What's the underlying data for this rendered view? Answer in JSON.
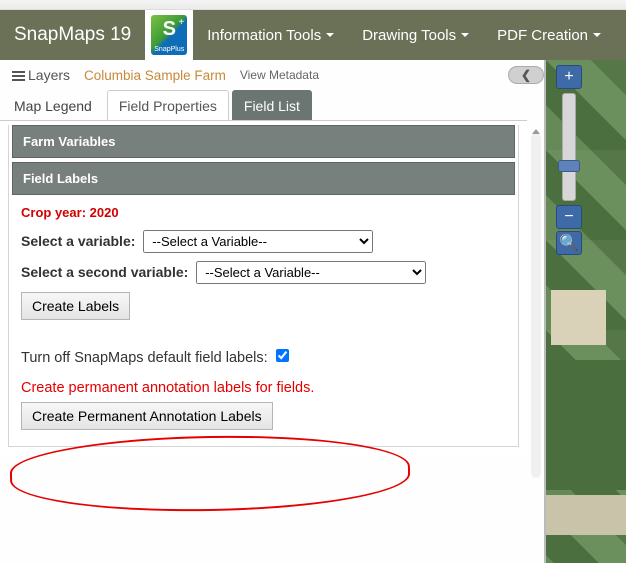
{
  "brand": "SnapMaps 19",
  "logo": {
    "letter": "S",
    "word": "SnapPlus"
  },
  "nav": [
    {
      "label": "Information Tools"
    },
    {
      "label": "Drawing Tools"
    },
    {
      "label": "PDF Creation"
    }
  ],
  "toolbar": {
    "layers": "Layers",
    "farm_name": "Columbia Sample Farm",
    "view_metadata": "View Metadata",
    "collapse_glyph": "❮"
  },
  "tabs": {
    "legend": "Map Legend",
    "properties": "Field Properties",
    "list": "Field List"
  },
  "accordion": {
    "farm_vars": "Farm Variables",
    "field_labels": "Field Labels"
  },
  "body": {
    "crop_year_label": "Crop year: 2020",
    "select1_label": "Select a variable:",
    "select2_label": "Select a second variable:",
    "select_placeholder": "--Select a Variable--",
    "create_labels_btn": "Create Labels",
    "toggle_label": "Turn off SnapMaps default field labels:",
    "annotation_note": "Create permanent annotation labels for fields.",
    "create_annotation_btn": "Create Permanent Annotation Labels"
  },
  "map_controls": {
    "zoom_in": "+",
    "zoom_out": "−",
    "search": "🔍"
  }
}
